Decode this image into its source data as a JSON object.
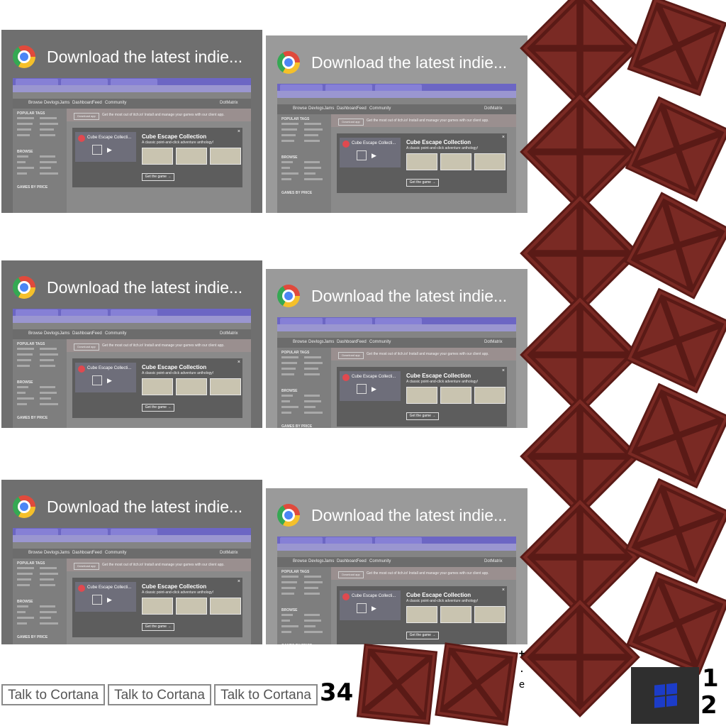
{
  "notification": {
    "title": "Download the latest indie...",
    "app_icon": "chrome-icon"
  },
  "browser_preview": {
    "nav_items": [
      "Browse",
      "Devlogs",
      "Jams",
      "Dashboard",
      "Feed",
      "Community"
    ],
    "user": "DotMatrix",
    "sidebar_headings": [
      "POPULAR TAGS",
      "BROWSE",
      "GAMES BY PRICE"
    ],
    "banner_button": "Download app",
    "banner_text": "Get the most out of itch.io! Install and manage your games with our client app.",
    "video_title": "Cube Escape Collecti...",
    "popup_title": "Cube Escape Collection",
    "popup_subtitle": "A classic point-and-click adventure anthology!",
    "cta": "Get the game →"
  },
  "cortana": {
    "label": "Talk to Cortana"
  },
  "counters": {
    "left": "34",
    "right_top": "1",
    "right_bottom": "2"
  },
  "tiny_marks": [
    "+",
    ".",
    "e"
  ],
  "colors": {
    "crate": "#7a2a24",
    "crate_edge": "#5a1a16",
    "start_bg": "#2f2f2f",
    "windows_blue": "#1c3cc8"
  }
}
